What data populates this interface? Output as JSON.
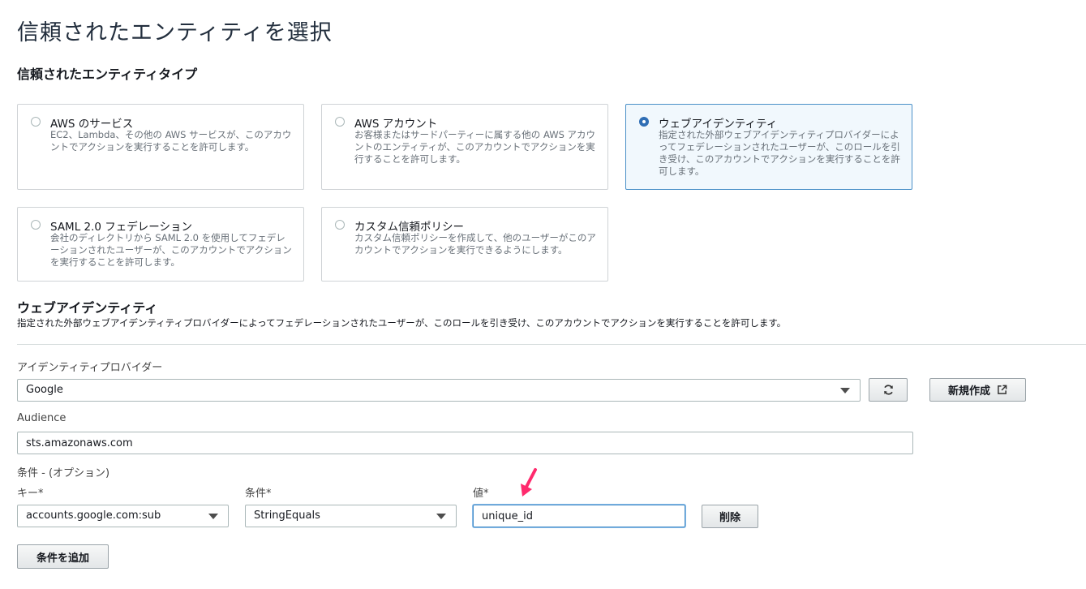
{
  "page": {
    "title": "信頼されたエンティティを選択"
  },
  "entity_type": {
    "heading": "信頼されたエンティティタイプ",
    "options": [
      {
        "title": "AWS のサービス",
        "desc": "EC2、Lambda、その他の AWS サービスが、このアカウントでアクションを実行することを許可します。",
        "selected": false
      },
      {
        "title": "AWS アカウント",
        "desc": "お客様またはサードパーティーに属する他の AWS アカウントのエンティティが、このアカウントでアクションを実行することを許可します。",
        "selected": false
      },
      {
        "title": "ウェブアイデンティティ",
        "desc": "指定された外部ウェブアイデンティティプロバイダーによってフェデレーションされたユーザーが、このロールを引き受け、このアカウントでアクションを実行することを許可します。",
        "selected": true
      },
      {
        "title": "SAML 2.0 フェデレーション",
        "desc": "会社のディレクトリから SAML 2.0 を使用してフェデレーションされたユーザーが、このアカウントでアクションを実行することを許可します。",
        "selected": false
      },
      {
        "title": "カスタム信頼ポリシー",
        "desc": "カスタム信頼ポリシーを作成して、他のユーザーがこのアカウントでアクションを実行できるようにします。",
        "selected": false
      }
    ]
  },
  "web_identity": {
    "heading": "ウェブアイデンティティ",
    "desc": "指定された外部ウェブアイデンティティプロバイダーによってフェデレーションされたユーザーが、このロールを引き受け、このアカウントでアクションを実行することを許可します。",
    "provider_label": "アイデンティティプロバイダー",
    "provider_value": "Google",
    "new_button": "新規作成",
    "audience_label": "Audience",
    "audience_value": "sts.amazonaws.com",
    "conditions_label": "条件 - (オプション)",
    "key_label": "キー*",
    "key_value": "accounts.google.com:sub",
    "condition_label": "条件*",
    "condition_value": "StringEquals",
    "value_label": "値*",
    "value_value": "unique_id",
    "delete_button": "削除",
    "add_condition_button": "条件を追加"
  },
  "colors": {
    "accent": "#2f6eb5",
    "annotation_arrow": "#ff2a6d"
  }
}
